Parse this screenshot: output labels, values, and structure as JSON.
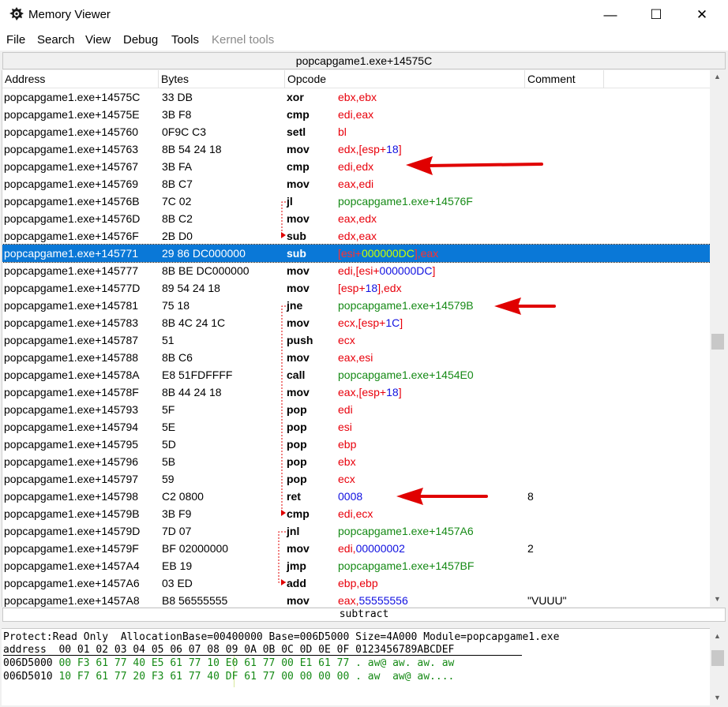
{
  "window": {
    "title": "Memory Viewer",
    "icon": "cheat-engine-icon"
  },
  "window_controls": {
    "minimize": "—",
    "maximize": "☐",
    "close": "✕"
  },
  "menu": [
    "File",
    "Search",
    "View",
    "Debug",
    "Tools",
    "Kernel tools"
  ],
  "address_bar": "popcapgame1.exe+14575C",
  "columns": [
    "Address",
    "Bytes",
    "Opcode",
    "Comment"
  ],
  "rows": [
    {
      "addr": "popcapgame1.exe+14575C",
      "bytes": "33 DB",
      "opcode": "xor",
      "ops": [
        [
          "ebx,ebx",
          "red"
        ]
      ],
      "comment": ""
    },
    {
      "addr": "popcapgame1.exe+14575E",
      "bytes": "3B F8",
      "opcode": "cmp",
      "ops": [
        [
          "edi,eax",
          "red"
        ]
      ],
      "comment": ""
    },
    {
      "addr": "popcapgame1.exe+145760",
      "bytes": "0F9C C3",
      "opcode": "setl",
      "ops": [
        [
          "bl",
          "red"
        ]
      ],
      "comment": ""
    },
    {
      "addr": "popcapgame1.exe+145763",
      "bytes": "8B 54 24 18",
      "opcode": "mov",
      "ops": [
        [
          "edx,[esp+",
          "red"
        ],
        [
          "18",
          "blue"
        ],
        [
          "]",
          "red"
        ]
      ],
      "comment": ""
    },
    {
      "addr": "popcapgame1.exe+145767",
      "bytes": "3B FA",
      "opcode": "cmp",
      "ops": [
        [
          "edi,edx",
          "red"
        ]
      ],
      "comment": ""
    },
    {
      "addr": "popcapgame1.exe+145769",
      "bytes": "8B C7",
      "opcode": "mov",
      "ops": [
        [
          "eax,edi",
          "red"
        ]
      ],
      "comment": ""
    },
    {
      "addr": "popcapgame1.exe+14576B",
      "bytes": "7C 02",
      "opcode": "jl",
      "ops": [
        [
          "popcapgame1.exe+14576F",
          "green"
        ]
      ],
      "comment": ""
    },
    {
      "addr": "popcapgame1.exe+14576D",
      "bytes": "8B C2",
      "opcode": "mov",
      "ops": [
        [
          "eax,edx",
          "red"
        ]
      ],
      "comment": ""
    },
    {
      "addr": "popcapgame1.exe+14576F",
      "bytes": "2B D0",
      "opcode": "sub",
      "ops": [
        [
          "edx,eax",
          "red"
        ]
      ],
      "comment": ""
    },
    {
      "addr": "popcapgame1.exe+145771",
      "bytes": "29 86 DC000000",
      "opcode": "sub",
      "ops": [
        [
          "[esi+",
          "red"
        ],
        [
          "000000DC",
          "green"
        ],
        [
          "],eax",
          "red"
        ]
      ],
      "comment": "",
      "selected": true
    },
    {
      "addr": "popcapgame1.exe+145777",
      "bytes": "8B BE DC000000",
      "opcode": "mov",
      "ops": [
        [
          "edi,[esi+",
          "red"
        ],
        [
          "000000DC",
          "blue"
        ],
        [
          "]",
          "red"
        ]
      ],
      "comment": ""
    },
    {
      "addr": "popcapgame1.exe+14577D",
      "bytes": "89 54 24 18",
      "opcode": "mov",
      "ops": [
        [
          "[esp+",
          "red"
        ],
        [
          "18",
          "blue"
        ],
        [
          "],edx",
          "red"
        ]
      ],
      "comment": ""
    },
    {
      "addr": "popcapgame1.exe+145781",
      "bytes": "75 18",
      "opcode": "jne",
      "ops": [
        [
          "popcapgame1.exe+14579B",
          "green"
        ]
      ],
      "comment": ""
    },
    {
      "addr": "popcapgame1.exe+145783",
      "bytes": "8B 4C 24 1C",
      "opcode": "mov",
      "ops": [
        [
          "ecx,[esp+",
          "red"
        ],
        [
          "1C",
          "blue"
        ],
        [
          "]",
          "red"
        ]
      ],
      "comment": ""
    },
    {
      "addr": "popcapgame1.exe+145787",
      "bytes": "51",
      "opcode": "push",
      "ops": [
        [
          "ecx",
          "red"
        ]
      ],
      "comment": ""
    },
    {
      "addr": "popcapgame1.exe+145788",
      "bytes": "8B C6",
      "opcode": "mov",
      "ops": [
        [
          "eax,esi",
          "red"
        ]
      ],
      "comment": ""
    },
    {
      "addr": "popcapgame1.exe+14578A",
      "bytes": "E8 51FDFFFF",
      "opcode": "call",
      "ops": [
        [
          "popcapgame1.exe+1454E0",
          "green"
        ]
      ],
      "comment": ""
    },
    {
      "addr": "popcapgame1.exe+14578F",
      "bytes": "8B 44 24 18",
      "opcode": "mov",
      "ops": [
        [
          "eax,[esp+",
          "red"
        ],
        [
          "18",
          "blue"
        ],
        [
          "]",
          "red"
        ]
      ],
      "comment": ""
    },
    {
      "addr": "popcapgame1.exe+145793",
      "bytes": "5F",
      "opcode": "pop",
      "ops": [
        [
          "edi",
          "red"
        ]
      ],
      "comment": ""
    },
    {
      "addr": "popcapgame1.exe+145794",
      "bytes": "5E",
      "opcode": "pop",
      "ops": [
        [
          "esi",
          "red"
        ]
      ],
      "comment": ""
    },
    {
      "addr": "popcapgame1.exe+145795",
      "bytes": "5D",
      "opcode": "pop",
      "ops": [
        [
          "ebp",
          "red"
        ]
      ],
      "comment": ""
    },
    {
      "addr": "popcapgame1.exe+145796",
      "bytes": "5B",
      "opcode": "pop",
      "ops": [
        [
          "ebx",
          "red"
        ]
      ],
      "comment": ""
    },
    {
      "addr": "popcapgame1.exe+145797",
      "bytes": "59",
      "opcode": "pop",
      "ops": [
        [
          "ecx",
          "red"
        ]
      ],
      "comment": ""
    },
    {
      "addr": "popcapgame1.exe+145798",
      "bytes": "C2 0800",
      "opcode": "ret",
      "ops": [
        [
          "0008",
          "blue"
        ]
      ],
      "comment": "8"
    },
    {
      "addr": "popcapgame1.exe+14579B",
      "bytes": "3B F9",
      "opcode": "cmp",
      "ops": [
        [
          "edi,ecx",
          "red"
        ]
      ],
      "comment": ""
    },
    {
      "addr": "popcapgame1.exe+14579D",
      "bytes": "7D 07",
      "opcode": "jnl",
      "ops": [
        [
          "popcapgame1.exe+1457A6",
          "green"
        ]
      ],
      "comment": ""
    },
    {
      "addr": "popcapgame1.exe+14579F",
      "bytes": "BF 02000000",
      "opcode": "mov",
      "ops": [
        [
          "edi,",
          "red"
        ],
        [
          "00000002",
          "blue"
        ]
      ],
      "comment": "2"
    },
    {
      "addr": "popcapgame1.exe+1457A4",
      "bytes": "EB 19",
      "opcode": "jmp",
      "ops": [
        [
          "popcapgame1.exe+1457BF",
          "green"
        ]
      ],
      "comment": ""
    },
    {
      "addr": "popcapgame1.exe+1457A6",
      "bytes": "03 ED",
      "opcode": "add",
      "ops": [
        [
          "ebp,ebp",
          "red"
        ]
      ],
      "comment": ""
    },
    {
      "addr": "popcapgame1.exe+1457A8",
      "bytes": "B8 56555555",
      "opcode": "mov",
      "ops": [
        [
          "eax,",
          "red"
        ],
        [
          "55555556",
          "blue"
        ]
      ],
      "comment": "\"VUUU\""
    }
  ],
  "status_text": "subtract",
  "hex_panel": {
    "info": "Protect:Read Only  AllocationBase=00400000 Base=006D5000 Size=4A000 Module=popcapgame1.exe",
    "header": "address  00 01 02 03 04 05 06 07 08 09 0A 0B 0C 0D 0E 0F 0123456789ABCDEF",
    "lines": [
      {
        "addr": "006D5000",
        "bytes": "00 F3 61 77 40 E5 61 77 10 E0 61 77 00 E1 61 77",
        "ascii": " . aw@ aw. aw. aw"
      },
      {
        "addr": "006D5010",
        "bytes": "10 F7 61 77 20 F3 61 77 40 DF 61 77 00 00 00 00",
        "ascii": " . aw  aw@ aw...."
      }
    ]
  },
  "colors": {
    "selection": "#0a78d7",
    "register": "#e8000b",
    "constant": "#1010e0",
    "address_ref": "#168a16",
    "annotation_arrow": "#e00000"
  }
}
